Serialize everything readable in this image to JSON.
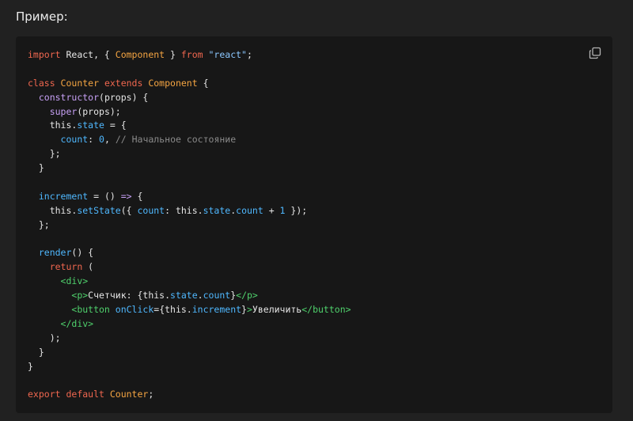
{
  "heading": "Пример:",
  "copy_icon": "copy-icon",
  "code": {
    "lines": [
      [
        {
          "t": "import ",
          "c": "kw"
        },
        {
          "t": "React, { ",
          "c": "txt"
        },
        {
          "t": "Component",
          "c": "cls"
        },
        {
          "t": " } ",
          "c": "txt"
        },
        {
          "t": "from ",
          "c": "kw"
        },
        {
          "t": "\"react\"",
          "c": "str"
        },
        {
          "t": ";",
          "c": "txt"
        }
      ],
      [],
      [
        {
          "t": "class ",
          "c": "kw"
        },
        {
          "t": "Counter ",
          "c": "cls"
        },
        {
          "t": "extends ",
          "c": "kw"
        },
        {
          "t": "Component",
          "c": "cls"
        },
        {
          "t": " {",
          "c": "txt"
        }
      ],
      [
        {
          "t": "  ",
          "c": "txt"
        },
        {
          "t": "constructor",
          "c": "fn"
        },
        {
          "t": "(props) {",
          "c": "txt"
        }
      ],
      [
        {
          "t": "    ",
          "c": "txt"
        },
        {
          "t": "super",
          "c": "fn"
        },
        {
          "t": "(props);",
          "c": "txt"
        }
      ],
      [
        {
          "t": "    this.",
          "c": "txt"
        },
        {
          "t": "state",
          "c": "prop"
        },
        {
          "t": " = {",
          "c": "txt"
        }
      ],
      [
        {
          "t": "      ",
          "c": "txt"
        },
        {
          "t": "count",
          "c": "prop"
        },
        {
          "t": ": ",
          "c": "txt"
        },
        {
          "t": "0",
          "c": "num"
        },
        {
          "t": ", ",
          "c": "txt"
        },
        {
          "t": "// Начальное состояние",
          "c": "cmt"
        }
      ],
      [
        {
          "t": "    };",
          "c": "txt"
        }
      ],
      [
        {
          "t": "  }",
          "c": "txt"
        }
      ],
      [],
      [
        {
          "t": "  ",
          "c": "txt"
        },
        {
          "t": "increment",
          "c": "prop"
        },
        {
          "t": " = () ",
          "c": "txt"
        },
        {
          "t": "=>",
          "c": "op"
        },
        {
          "t": " {",
          "c": "txt"
        }
      ],
      [
        {
          "t": "    this.",
          "c": "txt"
        },
        {
          "t": "setState",
          "c": "prop"
        },
        {
          "t": "({ ",
          "c": "txt"
        },
        {
          "t": "count",
          "c": "prop"
        },
        {
          "t": ": this.",
          "c": "txt"
        },
        {
          "t": "state",
          "c": "prop"
        },
        {
          "t": ".",
          "c": "txt"
        },
        {
          "t": "count",
          "c": "prop"
        },
        {
          "t": " + ",
          "c": "txt"
        },
        {
          "t": "1",
          "c": "num"
        },
        {
          "t": " });",
          "c": "txt"
        }
      ],
      [
        {
          "t": "  };",
          "c": "txt"
        }
      ],
      [],
      [
        {
          "t": "  ",
          "c": "txt"
        },
        {
          "t": "render",
          "c": "prop"
        },
        {
          "t": "() {",
          "c": "txt"
        }
      ],
      [
        {
          "t": "    ",
          "c": "txt"
        },
        {
          "t": "return",
          "c": "kw"
        },
        {
          "t": " (",
          "c": "txt"
        }
      ],
      [
        {
          "t": "      ",
          "c": "txt"
        },
        {
          "t": "<div>",
          "c": "tag"
        }
      ],
      [
        {
          "t": "        ",
          "c": "txt"
        },
        {
          "t": "<p>",
          "c": "tag"
        },
        {
          "t": "Счетчик: {this.",
          "c": "txt"
        },
        {
          "t": "state",
          "c": "prop"
        },
        {
          "t": ".",
          "c": "txt"
        },
        {
          "t": "count",
          "c": "prop"
        },
        {
          "t": "}",
          "c": "txt"
        },
        {
          "t": "</p>",
          "c": "tag"
        }
      ],
      [
        {
          "t": "        ",
          "c": "txt"
        },
        {
          "t": "<button ",
          "c": "tag"
        },
        {
          "t": "onClick",
          "c": "attr"
        },
        {
          "t": "=",
          "c": "txt"
        },
        {
          "t": "{this.",
          "c": "txt"
        },
        {
          "t": "increment",
          "c": "prop"
        },
        {
          "t": "}",
          "c": "txt"
        },
        {
          "t": ">",
          "c": "tag"
        },
        {
          "t": "Увеличить",
          "c": "txt"
        },
        {
          "t": "</button>",
          "c": "tag"
        }
      ],
      [
        {
          "t": "      ",
          "c": "txt"
        },
        {
          "t": "</div>",
          "c": "tag"
        }
      ],
      [
        {
          "t": "    );",
          "c": "txt"
        }
      ],
      [
        {
          "t": "  }",
          "c": "txt"
        }
      ],
      [
        {
          "t": "}",
          "c": "txt"
        }
      ],
      [],
      [
        {
          "t": "export ",
          "c": "kw"
        },
        {
          "t": "default ",
          "c": "kw"
        },
        {
          "t": "Counter",
          "c": "cls"
        },
        {
          "t": ";",
          "c": "txt"
        }
      ]
    ]
  }
}
